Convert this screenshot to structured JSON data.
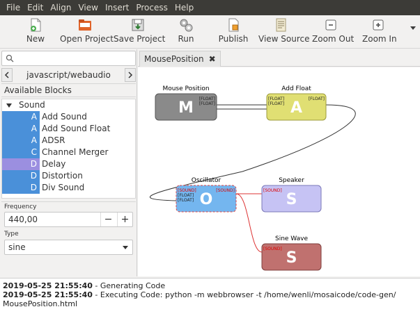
{
  "menu": [
    "File",
    "Edit",
    "Align",
    "View",
    "Insert",
    "Process",
    "Help"
  ],
  "toolbar": [
    {
      "label": "New",
      "icon": "new-file-icon"
    },
    {
      "label": "Open Project",
      "icon": "folder-icon"
    },
    {
      "label": "Save Project",
      "icon": "save-icon"
    },
    {
      "label": "Run",
      "icon": "gears-icon"
    },
    {
      "label": "Publish",
      "icon": "publish-icon"
    },
    {
      "label": "View Source",
      "icon": "source-icon"
    },
    {
      "label": "Zoom Out",
      "icon": "zoom-out-icon"
    },
    {
      "label": "Zoom In",
      "icon": "zoom-in-icon"
    }
  ],
  "library": {
    "name": "javascript/webaudio",
    "available_label": "Available Blocks",
    "category": "Sound",
    "items": [
      {
        "letter": "A",
        "name": "Add Sound",
        "color": "#4a90d9"
      },
      {
        "letter": "A",
        "name": "Add Sound Float",
        "color": "#4a90d9"
      },
      {
        "letter": "A",
        "name": "ADSR",
        "color": "#4a90d9"
      },
      {
        "letter": "C",
        "name": "Channel Merger",
        "color": "#4a90d9"
      },
      {
        "letter": "D",
        "name": "Delay",
        "color": "#9b8fe0"
      },
      {
        "letter": "D",
        "name": "Distortion",
        "color": "#4a90d9"
      },
      {
        "letter": "D",
        "name": "Div Sound",
        "color": "#4a90d9"
      }
    ]
  },
  "properties": {
    "frequency_label": "Frequency",
    "frequency_value": "440,00",
    "minus": "−",
    "plus": "+",
    "type_label": "Type",
    "type_value": "sine"
  },
  "tab": {
    "label": "MousePosition",
    "close": "✖"
  },
  "diagram": {
    "blocks": [
      {
        "id": "mouse",
        "title": "Mouse Position",
        "letter": "M",
        "fill": "#8a8a8a",
        "stroke": "#555555",
        "ports_out": [
          "[FLOAT]",
          "[FLOAT]"
        ],
        "ports_in": []
      },
      {
        "id": "add",
        "title": "Add Float",
        "letter": "A",
        "fill": "#e0df73",
        "stroke": "#9c9b3c",
        "ports_in": [
          "[FLOAT]",
          "[FLOAT]"
        ],
        "ports_out": [
          "[FLOAT]"
        ]
      },
      {
        "id": "osc",
        "title": "Oscillator",
        "letter": "O",
        "fill": "#74b6ef",
        "stroke": "#d44",
        "ports_in": [
          "[SOUND]",
          "[FLOAT]",
          "[FLOAT]"
        ],
        "ports_out": [
          "[SOUND]"
        ]
      },
      {
        "id": "speaker",
        "title": "Speaker",
        "letter": "S",
        "fill": "#c6c3f4",
        "stroke": "#7b78b8",
        "ports_in": [
          "[SOUND]"
        ],
        "ports_out": []
      },
      {
        "id": "sine",
        "title": "Sine Wave",
        "letter": "S",
        "fill": "#c0716f",
        "stroke": "#7f3f3d",
        "ports_in": [
          "[SOUND]"
        ],
        "ports_out": []
      }
    ],
    "connection_colors": {
      "normal": "#333333",
      "selected": "#dd3333"
    }
  },
  "console": {
    "lines": [
      {
        "time": "2019-05-25 21:55:40",
        "text": " - Generating Code"
      },
      {
        "time": "2019-05-25 21:55:40",
        "text": " - Executing Code: python -m webbrowser -t /home/wenli/mosaicode/code-gen/"
      },
      {
        "time": "",
        "text": "MousePosition.html"
      }
    ]
  }
}
